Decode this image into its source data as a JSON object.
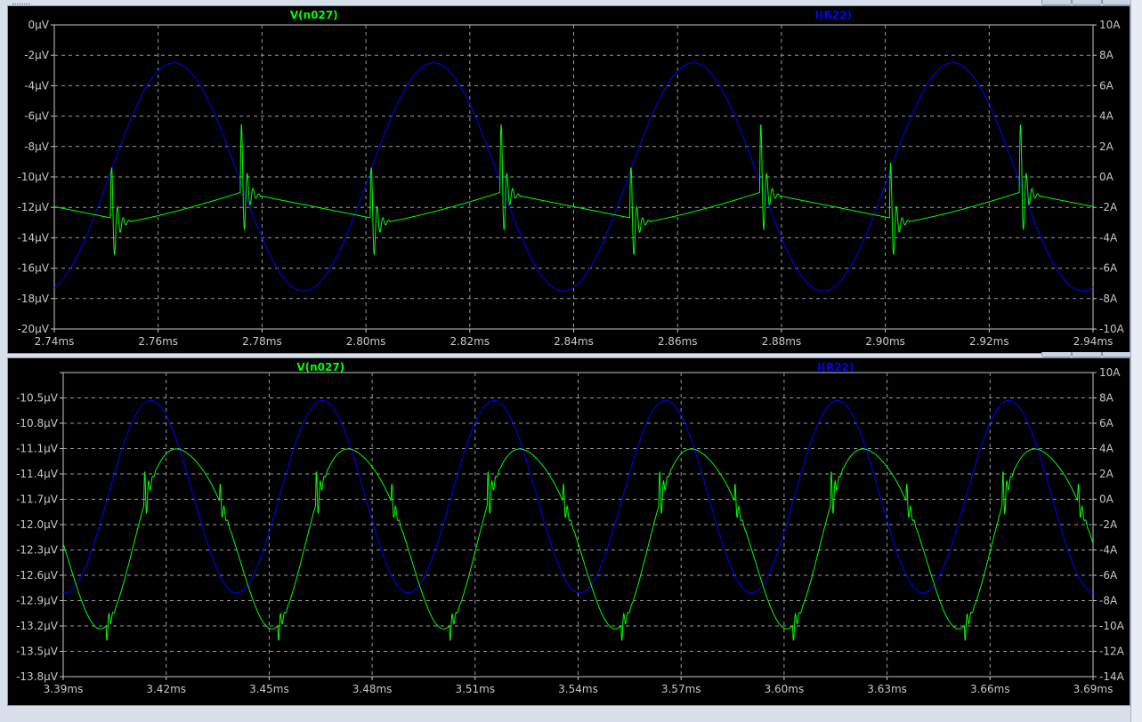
{
  "panes": [
    {
      "traces": [
        {
          "name": "V(n027)",
          "color": "#00ff00",
          "axis": "left"
        },
        {
          "name": "I(R22)",
          "color": "#0000ff",
          "axis": "right"
        }
      ],
      "x_ticks": [
        "2.74ms",
        "2.76ms",
        "2.78ms",
        "2.80ms",
        "2.82ms",
        "2.84ms",
        "2.86ms",
        "2.88ms",
        "2.90ms",
        "2.92ms",
        "2.94ms"
      ],
      "left_ticks": [
        "0µV",
        "-2µV",
        "-4µV",
        "-6µV",
        "-8µV",
        "-10µV",
        "-12µV",
        "-14µV",
        "-16µV",
        "-18µV",
        "-20µV"
      ],
      "right_ticks": [
        "10A",
        "8A",
        "6A",
        "4A",
        "2A",
        "0A",
        "-2A",
        "-4A",
        "-6A",
        "-8A",
        "-10A"
      ]
    },
    {
      "traces": [
        {
          "name": "V(n027)",
          "color": "#00ff00",
          "axis": "left"
        },
        {
          "name": "I(R22)",
          "color": "#0000ff",
          "axis": "right"
        }
      ],
      "x_ticks": [
        "3.39ms",
        "3.42ms",
        "3.45ms",
        "3.48ms",
        "3.51ms",
        "3.54ms",
        "3.57ms",
        "3.60ms",
        "3.63ms",
        "3.66ms",
        "3.69ms"
      ],
      "left_ticks": [
        "",
        "-10.5µV",
        "-10.8µV",
        "-11.1µV",
        "-11.4µV",
        "-11.7µV",
        "-12.0µV",
        "-12.3µV",
        "-12.6µV",
        "-12.9µV",
        "-13.2µV",
        "-13.5µV",
        "-13.8µV"
      ],
      "right_ticks": [
        "10A",
        "8A",
        "6A",
        "4A",
        "2A",
        "0A",
        "-2A",
        "-4A",
        "-6A",
        "-8A",
        "-10A",
        "-12A",
        "-14A"
      ]
    }
  ],
  "chart_data": [
    {
      "type": "line",
      "xlim_ms": [
        2.74,
        2.94
      ],
      "ylim_left_uV": [
        -20,
        0
      ],
      "ylim_right_A": [
        -10,
        10
      ],
      "grid": true,
      "series": [
        {
          "name": "V(n027)",
          "axis": "left",
          "model": "sawtooth baseline -13.1..-11 µV, period 0.05ms, ringing spikes ±5µV every 0.025ms",
          "period_ms": 0.05,
          "first_spike_ms": 2.751
        },
        {
          "name": "I(R22)",
          "axis": "right",
          "model": "sine",
          "amplitude_A": 7.5,
          "period_ms": 0.05,
          "first_peak_ms": 2.763
        }
      ]
    },
    {
      "type": "line",
      "xlim_ms": [
        3.39,
        3.69
      ],
      "ylim_left_uV": [
        -13.8,
        -10.2
      ],
      "ylim_right_A": [
        -14,
        10
      ],
      "grid": true,
      "series": [
        {
          "name": "V(n027)",
          "axis": "left",
          "model": "distorted sine -13.1..-11 µV with spikes",
          "period_ms": 0.05,
          "first_peak_ms": 3.425
        },
        {
          "name": "I(R22)",
          "axis": "right",
          "model": "sine",
          "amplitude_A": 7.7,
          "offset_A": 0.2,
          "period_ms": 0.05,
          "first_peak_ms": 3.4155
        }
      ]
    }
  ]
}
